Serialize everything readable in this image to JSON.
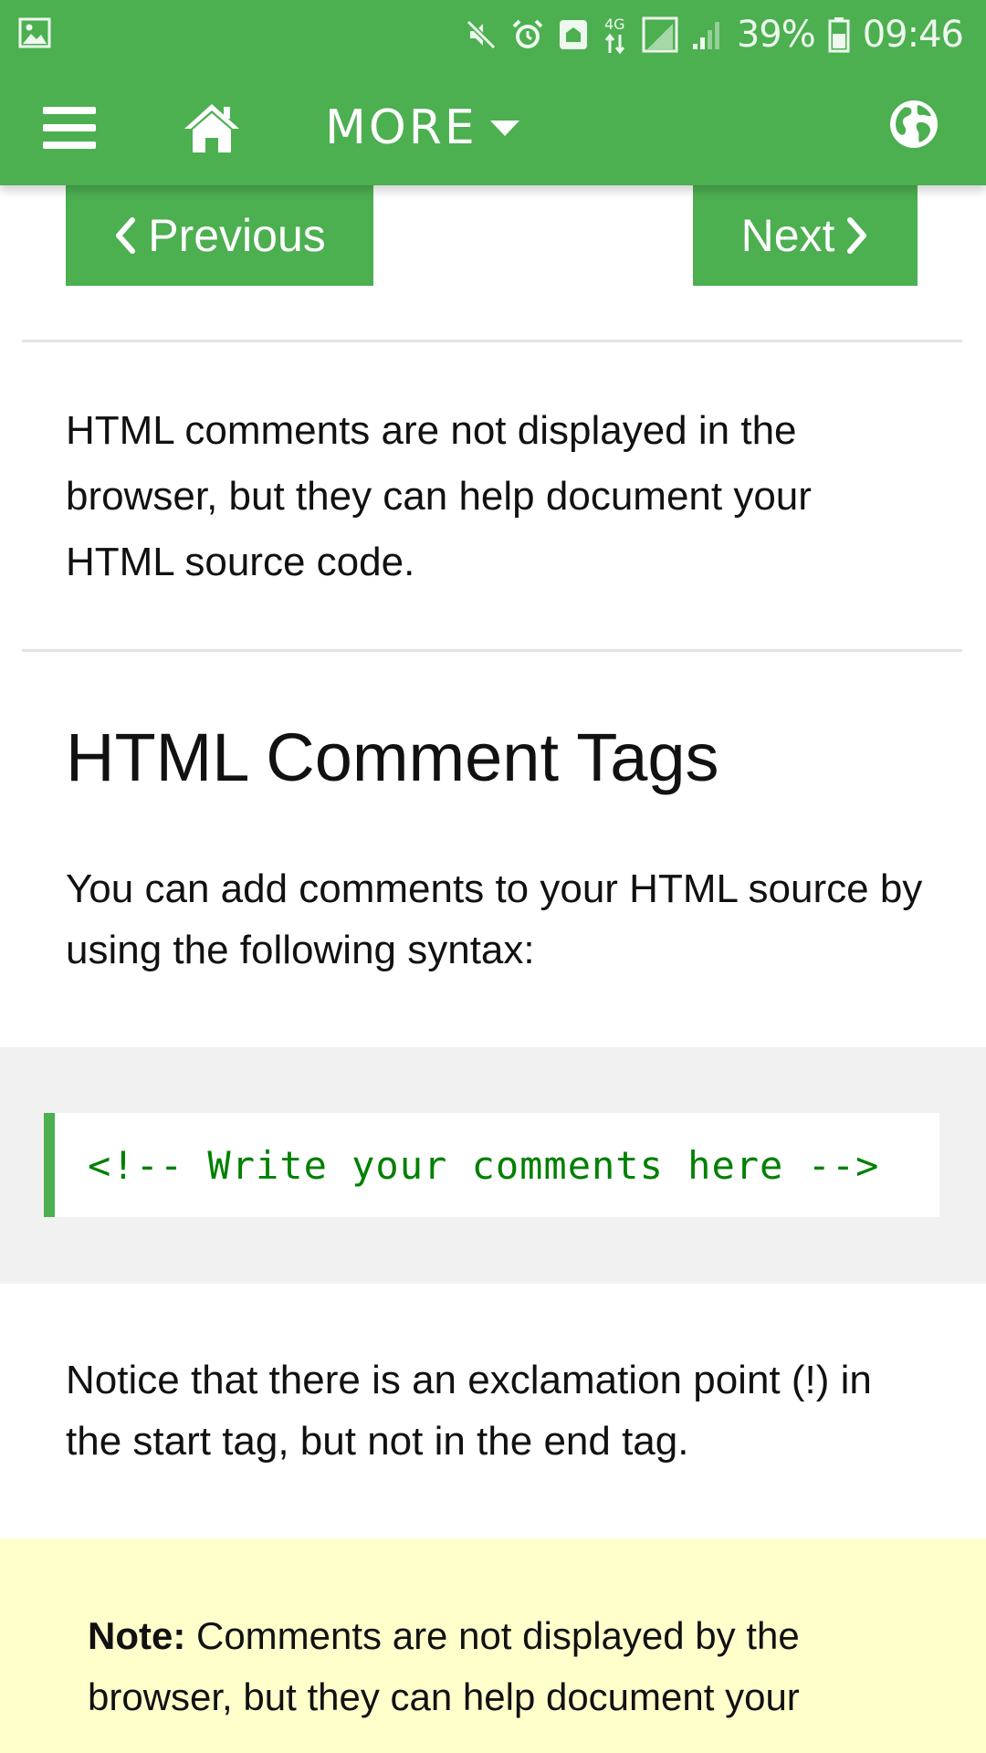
{
  "status_bar": {
    "battery_percent": "39%",
    "time": "09:46",
    "network_label": "4G",
    "icons": [
      "gallery-icon",
      "mute-icon",
      "alarm-icon",
      "nfc-icon",
      "data-arrows-icon",
      "sim-signal-icon",
      "signal-icon",
      "battery-icon"
    ]
  },
  "nav": {
    "more_label": "MORE",
    "icons": [
      "menu-icon",
      "home-icon",
      "caret-down-icon",
      "globe-icon"
    ]
  },
  "pager": {
    "previous_label": "Previous",
    "next_label": "Next"
  },
  "content": {
    "intro": "HTML comments are not displayed in the browser, but they can help document your HTML source code.",
    "heading": "HTML Comment Tags",
    "syntax_text": "You can add comments to your HTML source by using the following syntax:",
    "code": "<!-- Write your comments here -->",
    "notice": "Notice that there is an exclamation point (!) in the start tag, but not in the end tag.",
    "note_label": "Note:",
    "note_text": " Comments are not displayed by the browser, but they can help document your"
  },
  "colors": {
    "brand_green": "#4CAF50",
    "code_green": "#008000",
    "code_panel_bg": "#f1f1f1",
    "note_bg": "#ffffcc"
  }
}
